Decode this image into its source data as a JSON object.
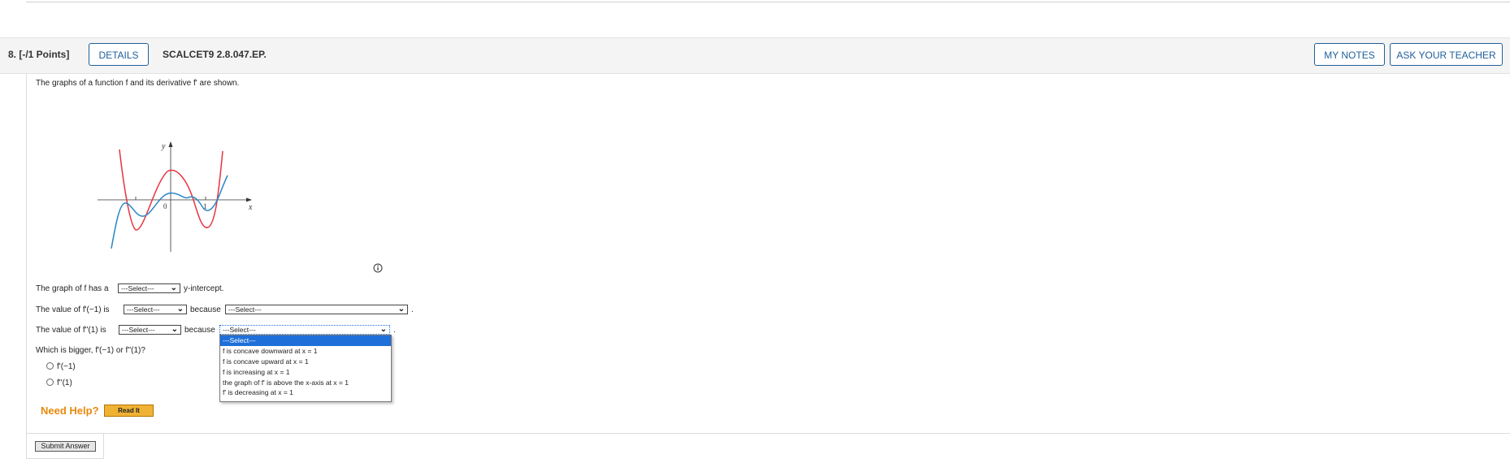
{
  "header": {
    "question_number": "8.  [-/1 Points]",
    "details_label": "DETAILS",
    "question_code": "SCALCET9 2.8.047.EP.",
    "my_notes_label": "MY NOTES",
    "ask_teacher_label": "ASK YOUR TEACHER"
  },
  "question": {
    "intro": "The graphs of a function f and its derivative f' are shown.",
    "graph_labels": {
      "y": "y",
      "x": "x",
      "origin": "0",
      "one": "1"
    },
    "colors": {
      "f_curve": "#e8343f",
      "fprime_curve": "#2a85c6"
    }
  },
  "part1": {
    "prefix": "The graph of f has a",
    "select_value": "---Select---",
    "suffix": "y-intercept."
  },
  "part2": {
    "prefix": "The value of f'(−1) is",
    "select_value": "---Select---",
    "because": "because",
    "reason_value": "---Select---",
    "suffix": "."
  },
  "part3": {
    "prefix": "The value of f''(1) is",
    "select_value": "---Select---",
    "because": "because",
    "reason_value": "---Select---",
    "suffix": "."
  },
  "dropdown": {
    "options": [
      "---Select---",
      "f is concave downward at x = 1",
      "f is concave upward at x = 1",
      "f is increasing at x = 1",
      "the graph of f' is above the x-axis at x = 1",
      "f' is decreasing at x = 1"
    ],
    "selected_index": 0,
    "highlight_color": "#1e6fd9"
  },
  "compare": {
    "question": "Which is bigger, f'(−1) or f''(1)?",
    "options": [
      "f'(−1)",
      "f''(1)"
    ]
  },
  "help": {
    "need_help": "Need Help?",
    "read_it": "Read It"
  },
  "submit_label": "Submit Answer"
}
